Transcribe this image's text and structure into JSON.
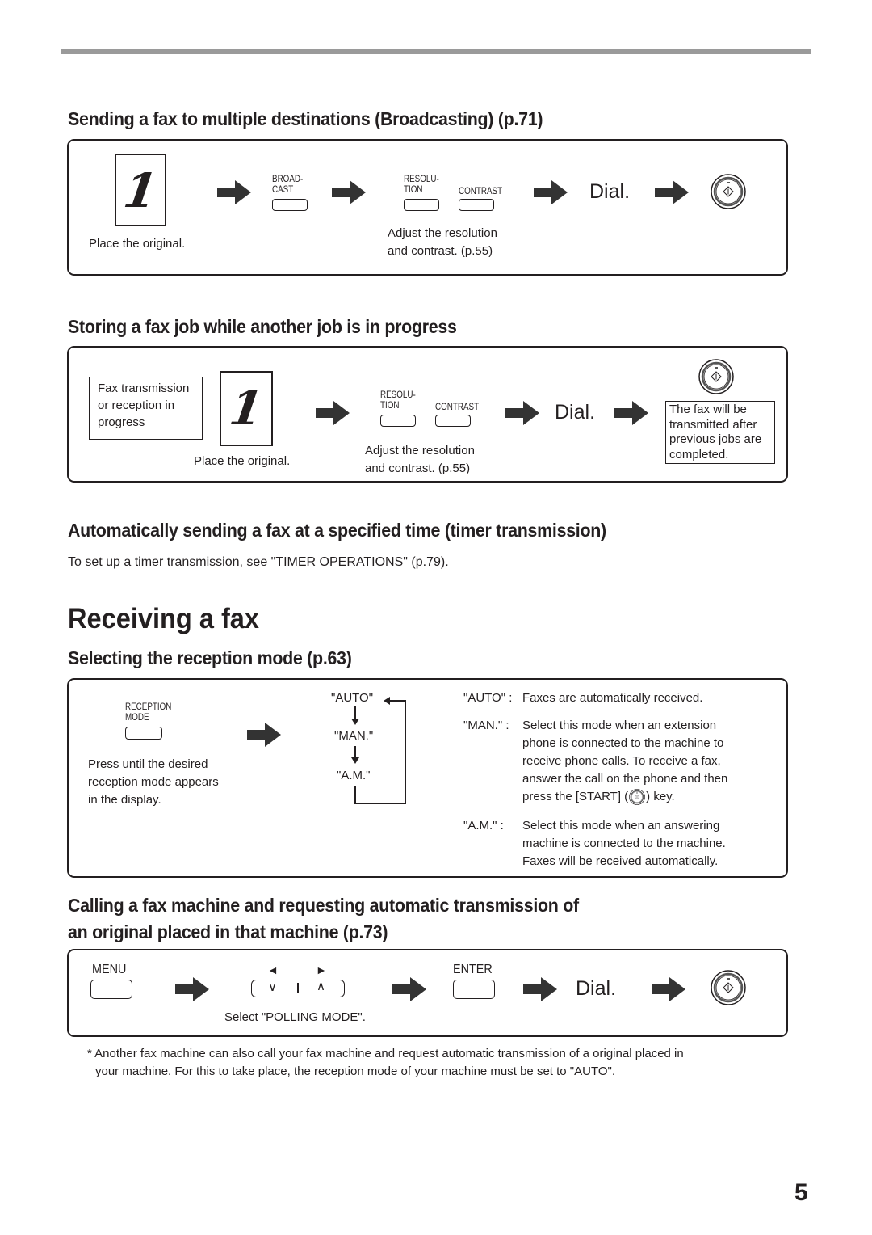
{
  "sections": {
    "broadcast": {
      "title": "Sending a fax to multiple destinations (Broadcasting) (p.71)",
      "place_original": "Place the original.",
      "doc_digit": "1",
      "broadcast_key": [
        "BROAD-",
        "CAST"
      ],
      "resolution_key": [
        "RESOLU-",
        "TION"
      ],
      "contrast_key": "CONTRAST",
      "adjust_note": [
        "Adjust the resolution",
        "and contrast. (p.55)"
      ],
      "dial": "Dial."
    },
    "storing": {
      "title": "Storing a fax job while another job is in progress",
      "status_box": [
        "Fax transmission",
        "or reception in",
        "progress"
      ],
      "place_original": "Place the original.",
      "doc_digit": "1",
      "resolution_key": [
        "RESOLU-",
        "TION"
      ],
      "contrast_key": "CONTRAST",
      "adjust_note": [
        "Adjust the resolution",
        "and contrast. (p.55)"
      ],
      "dial": "Dial.",
      "result_box": [
        "The fax will be",
        "transmitted after",
        "previous jobs are",
        "completed."
      ]
    },
    "timer": {
      "title": "Automatically sending a fax at a specified time (timer transmission)",
      "text": "To set up a timer transmission, see \"TIMER OPERATIONS\" (p.79)."
    },
    "receiving": {
      "title": "Receiving a fax"
    },
    "reception_mode": {
      "title": "Selecting the reception mode (p.63)",
      "key_label": [
        "RECEPTION",
        "MODE"
      ],
      "press_note": [
        "Press until the desired",
        "reception mode appears",
        "in the display."
      ],
      "cycle": [
        "\"AUTO\"",
        "\"MAN.\"",
        "\"A.M.\""
      ],
      "modes": [
        {
          "label": "\"AUTO\" :",
          "desc": [
            "Faxes are automatically received."
          ]
        },
        {
          "label": "\"MAN.\" :",
          "desc": [
            "Select this mode when an extension",
            "phone is connected to the machine to",
            "receive phone calls. To receive a fax,",
            "answer the call on the phone and then"
          ],
          "desc_end_pre": "press the [START] (",
          "desc_end_post": ") key."
        },
        {
          "label": "\"A.M.\" :",
          "desc": [
            "Select this mode when an answering",
            "machine is connected to the machine.",
            "Faxes will be received automatically."
          ]
        }
      ]
    },
    "polling": {
      "title": [
        "Calling a fax machine and requesting automatic transmission of",
        "an original placed in that machine (p.73)"
      ],
      "menu_key": "MENU",
      "left_arrow": "◄",
      "right_arrow": "►",
      "down_glyph": "∨",
      "up_glyph": "∧",
      "select_note": "Select \"POLLING MODE\".",
      "enter_key": "ENTER",
      "dial": "Dial."
    },
    "footnote": [
      "* Another fax machine can also call your fax machine and request automatic transmission of a original placed in",
      "your machine. For this to take place, the reception mode of your machine must be set to \"AUTO\"."
    ]
  },
  "page_number": "5",
  "colors": {
    "ink": "#231f20",
    "rule": "#9a9a9a",
    "arrow": "#333333"
  }
}
